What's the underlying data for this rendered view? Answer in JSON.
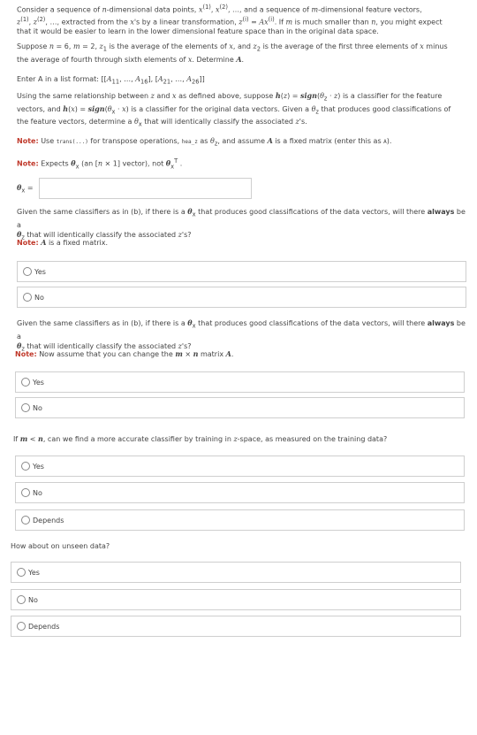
{
  "intro": {
    "p1_a": "Consider a sequence of",
    "p1_b": "-dimensional data points,",
    "p1_c": ", and a sequence of",
    "p1_d": "-dimensional feature vectors,",
    "p1_e": ", extracted from the",
    "p1_f": "'s by a linear transformation,",
    "p1_g": ". If",
    "p1_h": "is much smaller than",
    "p1_i": ", you might expect",
    "p1_j": "that it would be easier to learn in the lower dimensional feature space than in the original data space.",
    "p2_a": "Suppose",
    "p2_b": ", ",
    "p2_c": "is the average of the elements of",
    "p2_d": ", and",
    "p2_e": "is the average of the first three elements of",
    "p2_f": "minus",
    "p2_g": "the average of fourth through sixth elements of",
    "p2_h": ". Determine"
  },
  "list_format": {
    "text": "Enter A in a list format:"
  },
  "part_b": {
    "t1": "Using the same relationship between",
    "t2": "and",
    "t3": "as defined above, suppose",
    "t4": "is a classifier for the feature",
    "t5": "vectors, and",
    "t6": "is a classifier for the original data vectors. Given a",
    "t7": "that produces good classifications of",
    "t8": "the feature vectors, determine a",
    "t9": "that will identically classify the associated",
    "t10": "'s.",
    "note1_label": "Note:",
    "note1_a": "Use",
    "note1_code": "trans(...)",
    "note1_b": "for transpose operations,",
    "note1_code2": "hea_z",
    "note1_c": "as",
    "note1_d": ", and assume",
    "note1_e": "is a fixed matrix (enter this as",
    "note1_code3": "A",
    "note1_f": ").",
    "note2_label": "Note:",
    "note2_a": "Expects",
    "note2_b": "(an",
    "note2_c": "vector), not",
    "input_label": "θx =",
    "input_value": ""
  },
  "q_c": {
    "text_a": "Given the same classifiers as in (b), if there is a",
    "text_b": "that produces good classifications of the data vectors, will there",
    "text_always": "always",
    "text_c": "be a",
    "text_d": "that will identically classify the associated",
    "text_e": "'s?",
    "note_label": "Note:",
    "note_text": "is a fixed matrix.",
    "options": [
      "Yes",
      "No"
    ]
  },
  "q_d": {
    "text_a": "Given the same classifiers as in (b), if there is a",
    "text_b": "that produces good classifications of the data vectors, will there",
    "text_always": "always",
    "text_c": "be a",
    "text_d": "that will identically classify the associated",
    "text_e": "'s?",
    "note_label": "Note:",
    "note_text": "Now assume that you can change the",
    "note_text2": "matrix",
    "options": [
      "Yes",
      "No"
    ]
  },
  "q_e": {
    "text_a": "If",
    "text_b": ", can we find a more accurate classifier by training in",
    "text_c": "-space, as measured on the training data?",
    "options": [
      "Yes",
      "No",
      "Depends"
    ]
  },
  "q_f": {
    "text": "How about on unseen data?",
    "options": [
      "Yes",
      "No",
      "Depends"
    ]
  }
}
